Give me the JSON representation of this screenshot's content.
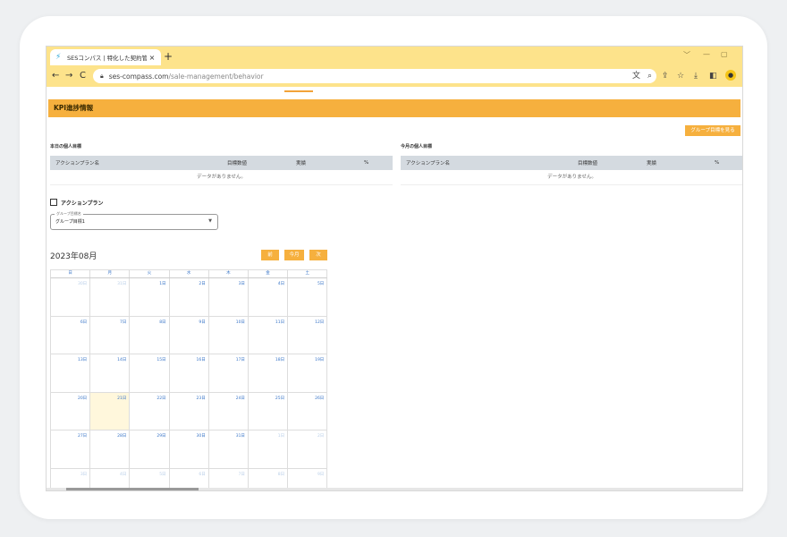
{
  "browser": {
    "tab_title": "SESコンパス | 特化した契約管理・案",
    "tab_close": "×",
    "new_tab": "+",
    "back": "←",
    "forward": "→",
    "reload": "C",
    "url_domain": "ses-compass.com",
    "url_path": "/sale-management/behavior",
    "window_controls": [
      "﹀",
      "—",
      "▢"
    ]
  },
  "page": {
    "header": "KPI進捗情報",
    "group_button": "グループ目標を見る",
    "today_section": {
      "label": "本日の個人目標",
      "columns": [
        "アクションプラン名",
        "目標数値",
        "実績",
        "%"
      ],
      "empty": "データがありません。"
    },
    "month_section": {
      "label": "今月の個人目標",
      "columns": [
        "アクションプラン名",
        "目標数値",
        "実績",
        "%"
      ],
      "empty": "データがありません。"
    },
    "action_plan": {
      "label": "アクションプラン",
      "select_legend": "グループ目標名",
      "select_value": "グループ目標1"
    },
    "calendar": {
      "month": "2023年08月",
      "buttons": [
        "前",
        "今月",
        "次"
      ],
      "weekdays": [
        "日",
        "月",
        "火",
        "水",
        "木",
        "金",
        "土"
      ],
      "days": [
        {
          "label": "30日",
          "other": true
        },
        {
          "label": "31日",
          "other": true
        },
        {
          "label": "1日"
        },
        {
          "label": "2日"
        },
        {
          "label": "3日"
        },
        {
          "label": "4日"
        },
        {
          "label": "5日"
        },
        {
          "label": "6日"
        },
        {
          "label": "7日"
        },
        {
          "label": "8日"
        },
        {
          "label": "9日"
        },
        {
          "label": "10日"
        },
        {
          "label": "11日"
        },
        {
          "label": "12日"
        },
        {
          "label": "13日"
        },
        {
          "label": "14日"
        },
        {
          "label": "15日"
        },
        {
          "label": "16日"
        },
        {
          "label": "17日"
        },
        {
          "label": "18日"
        },
        {
          "label": "19日"
        },
        {
          "label": "20日"
        },
        {
          "label": "21日",
          "today": true
        },
        {
          "label": "22日"
        },
        {
          "label": "23日"
        },
        {
          "label": "24日"
        },
        {
          "label": "25日"
        },
        {
          "label": "26日"
        },
        {
          "label": "27日"
        },
        {
          "label": "28日"
        },
        {
          "label": "29日"
        },
        {
          "label": "30日"
        },
        {
          "label": "31日"
        },
        {
          "label": "1日",
          "other": true
        },
        {
          "label": "2日",
          "other": true
        },
        {
          "label": "3日",
          "other": true
        },
        {
          "label": "4日",
          "other": true
        },
        {
          "label": "5日",
          "other": true
        },
        {
          "label": "6日",
          "other": true
        },
        {
          "label": "7日",
          "other": true
        },
        {
          "label": "8日",
          "other": true
        },
        {
          "label": "9日",
          "other": true
        }
      ]
    }
  },
  "colors": {
    "accent": "#f6b03e",
    "chrome": "#fde38b",
    "link": "#3a76c8"
  }
}
